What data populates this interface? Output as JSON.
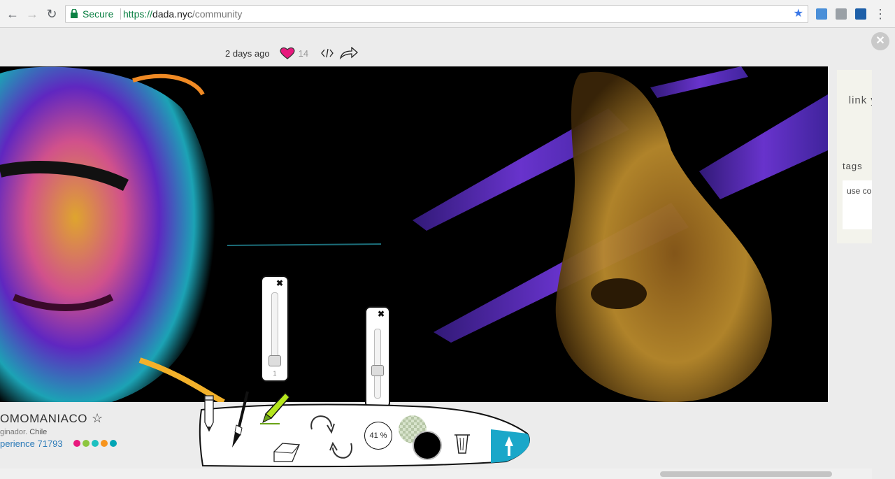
{
  "browser": {
    "secure_label": "Secure",
    "url_scheme": "https://",
    "url_host": "dada.nyc",
    "url_path": "/community"
  },
  "post": {
    "time_ago": "2 days ago",
    "likes": "14"
  },
  "side_panel": {
    "link_text": "link y you",
    "tags_label": "tags",
    "tags_placeholder": "use co"
  },
  "user": {
    "name": "OMOMANIACO",
    "role_prefix": "ginador.",
    "location": "Chile",
    "experience_label": "perience 71793",
    "color_dots": [
      "#e8197d",
      "#8dc63f",
      "#1cc0c0",
      "#f7941d",
      "#00a5b5"
    ]
  },
  "toolbar": {
    "size_value": "1",
    "opacity_value": "41 %"
  },
  "colors": {
    "accent": "#1aa7c9",
    "heart": "#e8197d",
    "pencil_green": "#b5e61d"
  }
}
